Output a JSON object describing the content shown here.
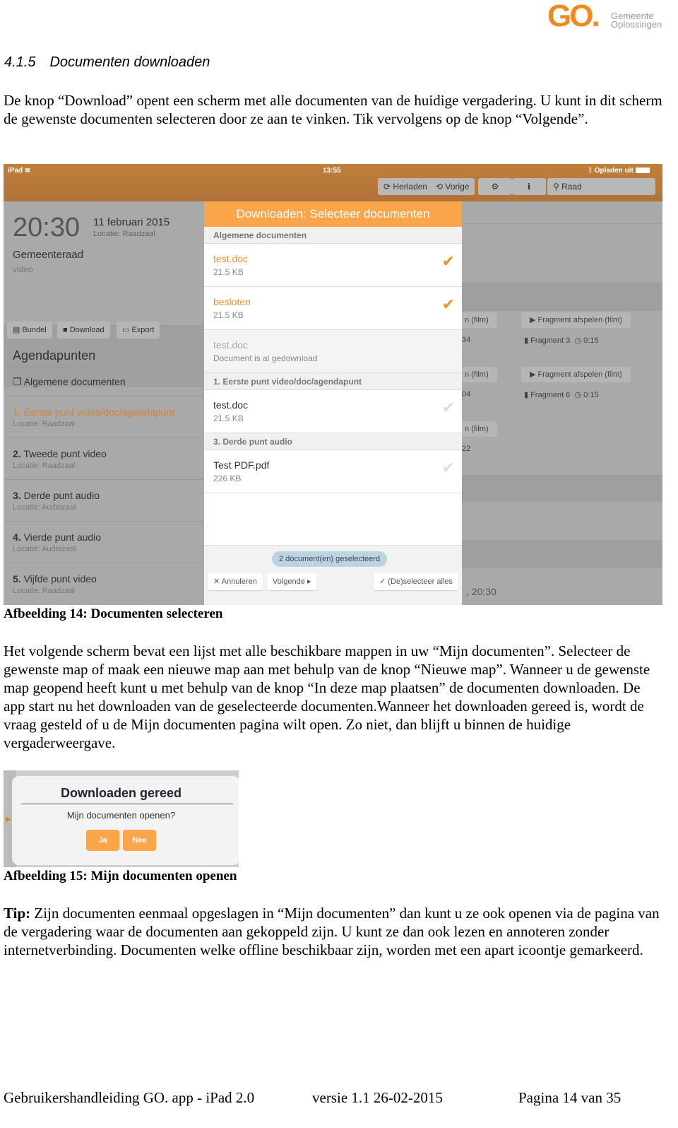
{
  "logo": {
    "mark": "GO.",
    "line1": "Gemeente",
    "line2": "Oplossingen",
    "color": "#f08a1c"
  },
  "section": {
    "number": "4.1.5",
    "title": "Documenten downloaden"
  },
  "paragraphs": [
    "De knop “Download” opent een scherm met alle documenten van de huidige vergadering. U kunt in dit scherm de gewenste documenten selecteren door ze aan te vinken. Tik vervolgens op de knop “Volgende”.",
    "Het volgende scherm bevat een lijst met alle beschikbare mappen in uw “Mijn documenten”. Selecteer de gewenste map of maak een nieuwe map aan met behulp van de knop “Nieuwe map”. Wanneer u de gewenste map geopend heeft kunt u met behulp van de knop “In deze map plaatsen” de documenten downloaden. De app start nu het downloaden van de geselecteerde documenten.Wanneer het downloaden gereed is, wordt de vraag gesteld of u de Mijn documenten pagina wilt open. Zo niet, dan blijft u binnen de huidige vergaderweergave."
  ],
  "tip": {
    "label": "Tip:",
    "text": " Zijn documenten eenmaal opgeslagen in “Mijn documenten” dan kunt u ze ook openen via de pagina van de vergadering waar de documenten aan gekoppeld zijn. U kunt ze dan ook lezen en annoteren zonder internetverbinding. Documenten welke offline beschikbaar zijn, worden met een apart icoontje gemarkeerd."
  },
  "captions": [
    "Afbeelding 14: Documenten selecteren",
    "Afbeelding 15: Mijn documenten openen"
  ],
  "ipad": {
    "status": {
      "device": "iPad",
      "time": "13:55",
      "battery": "Opladen uit"
    },
    "toolbar": {
      "reload": "Herladen",
      "previous": "Vorige",
      "search": "Raad"
    },
    "meeting": {
      "time": "20:30",
      "date": "11 februari 2015",
      "location": "Locatie: Raadzaal",
      "name": "Gemeenteraad",
      "type": "video"
    },
    "actions": {
      "bundle": "Bundel",
      "download": "Download",
      "export": "Export"
    },
    "agenda_title": "Agendapunten",
    "general_docs": "Algemene documenten",
    "agenda": [
      {
        "num": "1.",
        "title": "Eerste punt video/doc/agendapunt",
        "loc": "Locatie: Raadzaal"
      },
      {
        "num": "2.",
        "title": "Tweede punt video",
        "loc": "Locatie: Raadzaal"
      },
      {
        "num": "3.",
        "title": "Derde punt audio",
        "loc": "Locatie: Audiozaal"
      },
      {
        "num": "4.",
        "title": "Vierde punt audio",
        "loc": "Locatie: Audiozaal"
      },
      {
        "num": "5.",
        "title": "Vijfde punt video",
        "loc": "Locatie: Raadzaal"
      }
    ],
    "modal": {
      "title": "Downloaden: Selecteer documenten",
      "sections": [
        "Algemene documenten",
        "1. Eerste punt video/doc/agendapunt",
        "3. Derde punt audio"
      ],
      "items": [
        {
          "name": "test.doc",
          "sub": "21.5 KB",
          "checked": true
        },
        {
          "name": "besloten",
          "sub": "21.5 KB",
          "checked": true
        },
        {
          "name": "test.doc",
          "sub": "Document is al gedownload",
          "checked": false
        },
        {
          "name": "test.doc",
          "sub": "21.5 KB",
          "checked": false
        },
        {
          "name": "Test PDF.pdf",
          "sub": "226 KB",
          "checked": false
        }
      ],
      "selected_count": "2 document(en) geselecteerd",
      "cancel": "Annuleren",
      "next": "Volgende",
      "toggle_all": "(De)selecteer alles"
    },
    "right": {
      "partial_btn": "n (film)",
      "play": "Fragment afspelen (film)",
      "partial_meta": [
        "34",
        "04",
        "22"
      ],
      "fragments": [
        {
          "name": "Fragment 3",
          "dur": "0:15"
        },
        {
          "name": "Fragment 6",
          "dur": "0:15"
        }
      ],
      "bottom_time": ", 20:30"
    }
  },
  "dialog": {
    "title": "Downloaden gereed",
    "message": "Mijn documenten openen?",
    "yes": "Ja",
    "no": "Nee"
  },
  "footer": {
    "left": "Gebruikershandleiding GO. app - iPad 2.0",
    "middle": "versie 1.1 26-02-2015",
    "right": "Pagina 14 van 35"
  }
}
